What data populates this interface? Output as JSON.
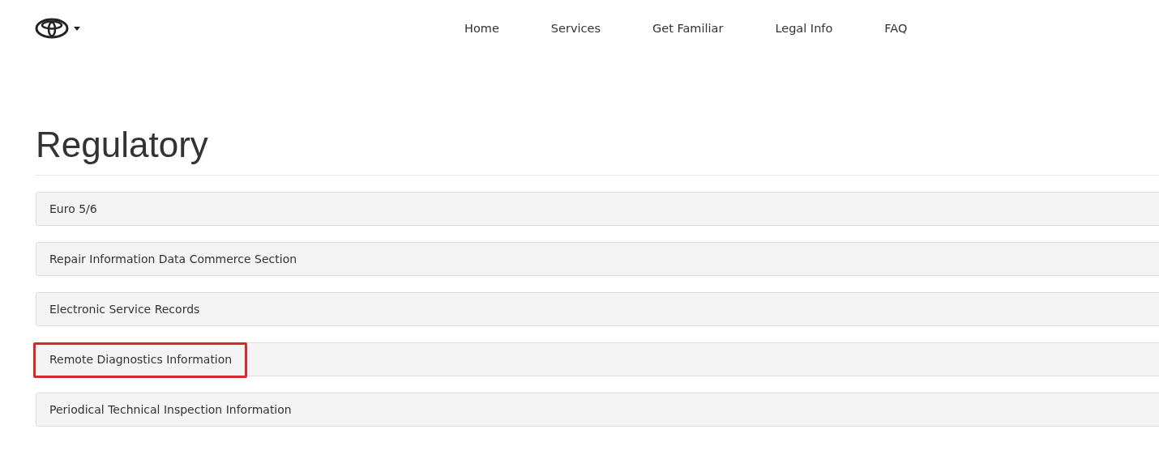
{
  "header": {
    "logo_menu": {
      "expanded": false
    },
    "nav": [
      {
        "label": "Home"
      },
      {
        "label": "Services"
      },
      {
        "label": "Get Familiar"
      },
      {
        "label": "Legal Info"
      },
      {
        "label": "FAQ"
      }
    ]
  },
  "page": {
    "title": "Regulatory",
    "panels": [
      {
        "title": "Euro 5/6",
        "highlighted": false
      },
      {
        "title": "Repair Information Data Commerce Section",
        "highlighted": false
      },
      {
        "title": "Electronic Service Records",
        "highlighted": false
      },
      {
        "title": "Remote Diagnostics Information",
        "highlighted": true
      },
      {
        "title": "Periodical Technical Inspection Information",
        "highlighted": false
      }
    ]
  }
}
